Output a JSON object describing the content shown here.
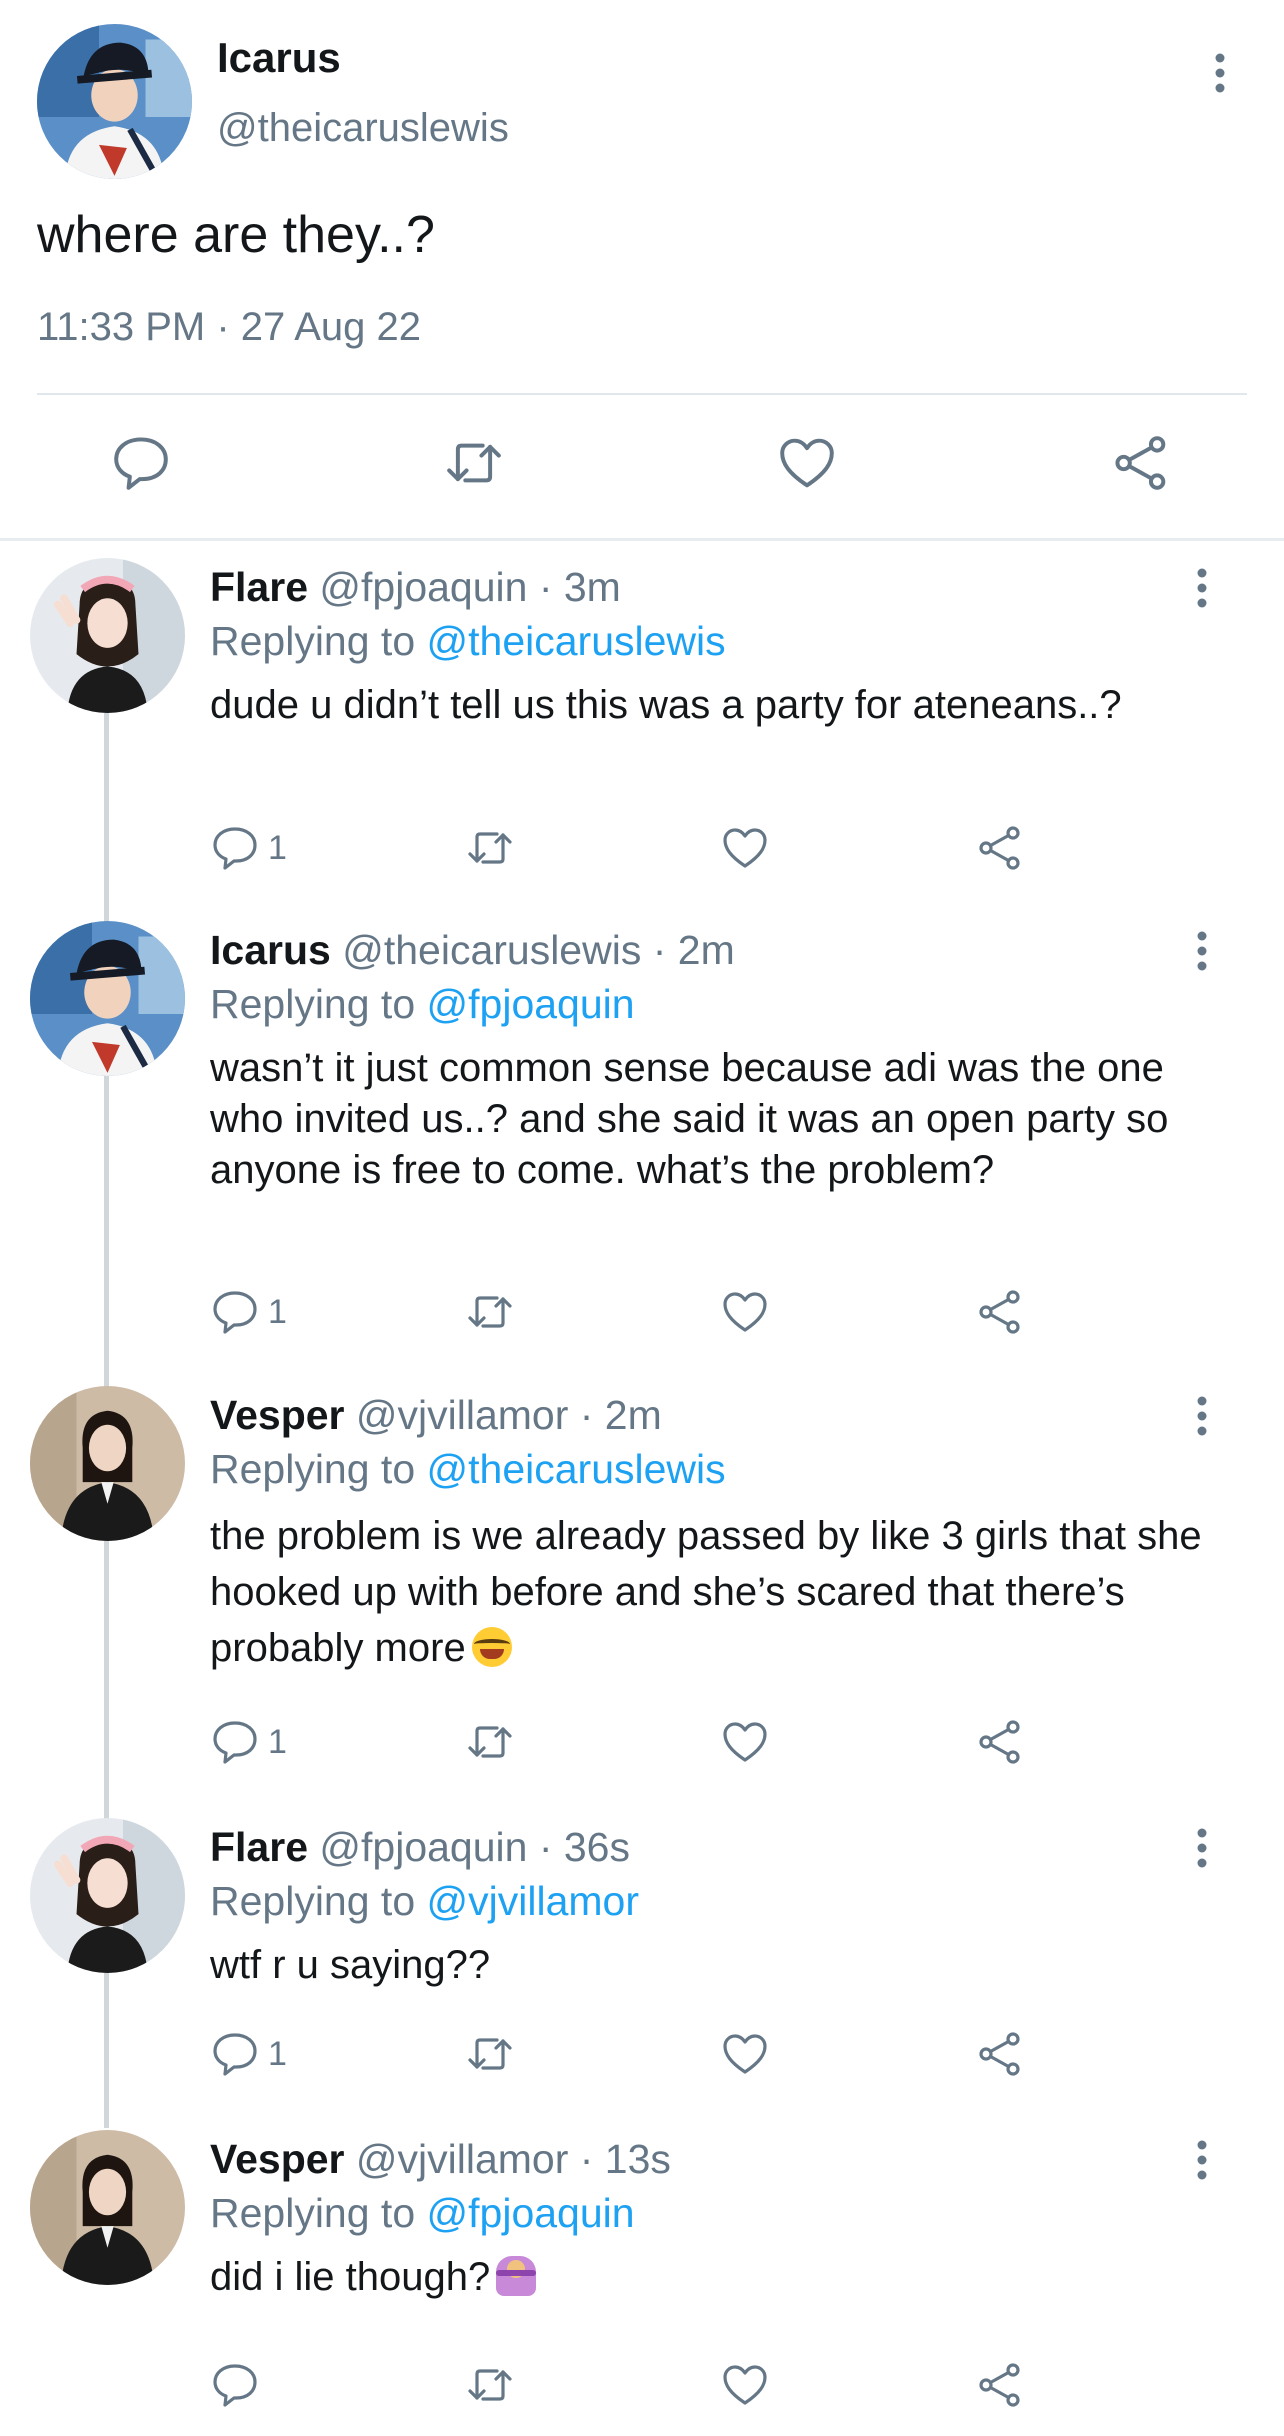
{
  "main_tweet": {
    "name": "Icarus",
    "handle": "@theicaruslewis",
    "text": "where are they..?",
    "timestamp": "11:33 PM · 27 Aug 22",
    "actions": [
      "reply-icon",
      "retweet-icon",
      "like-icon",
      "share-icon"
    ]
  },
  "replies": [
    {
      "name": "Flare",
      "meta": "@fpjoaquin · 3m",
      "replying_prefix": "Replying to",
      "mention": "@theicaruslewis",
      "text": "dude u didn’t tell us this was a party for ateneans..?",
      "reply_count": "1"
    },
    {
      "name": "Icarus",
      "meta": "@theicaruslewis · 2m",
      "replying_prefix": "Replying to",
      "mention": "@fpjoaquin",
      "text": "wasn’t it just common sense because adi was the one who invited us..? and she said it was an open party so anyone is free to come. what’s the problem?",
      "reply_count": "1"
    },
    {
      "name": "Vesper",
      "meta": "@vjvillamor · 2m",
      "replying_prefix": "Replying to",
      "mention": "@theicaruslewis",
      "text": "the problem is we already passed by like 3 girls that she hooked up with before and she’s scared that there’s probably more",
      "emoji": "laughing-tears-emoji",
      "reply_count": "1"
    },
    {
      "name": "Flare",
      "meta": "@fpjoaquin · 36s",
      "replying_prefix": "Replying to",
      "mention": "@vjvillamor",
      "text": "wtf r u saying??",
      "reply_count": "1"
    },
    {
      "name": "Vesper",
      "meta": "@vjvillamor · 13s",
      "replying_prefix": "Replying to",
      "mention": "@fpjoaquin",
      "text": "did i lie though?",
      "emoji": "person-shrugging-emoji",
      "reply_count": ""
    }
  ],
  "colors": {
    "text": "#14171a",
    "secondary": "#657786",
    "link": "#1da1f2",
    "divider": "#e1e8ed"
  }
}
